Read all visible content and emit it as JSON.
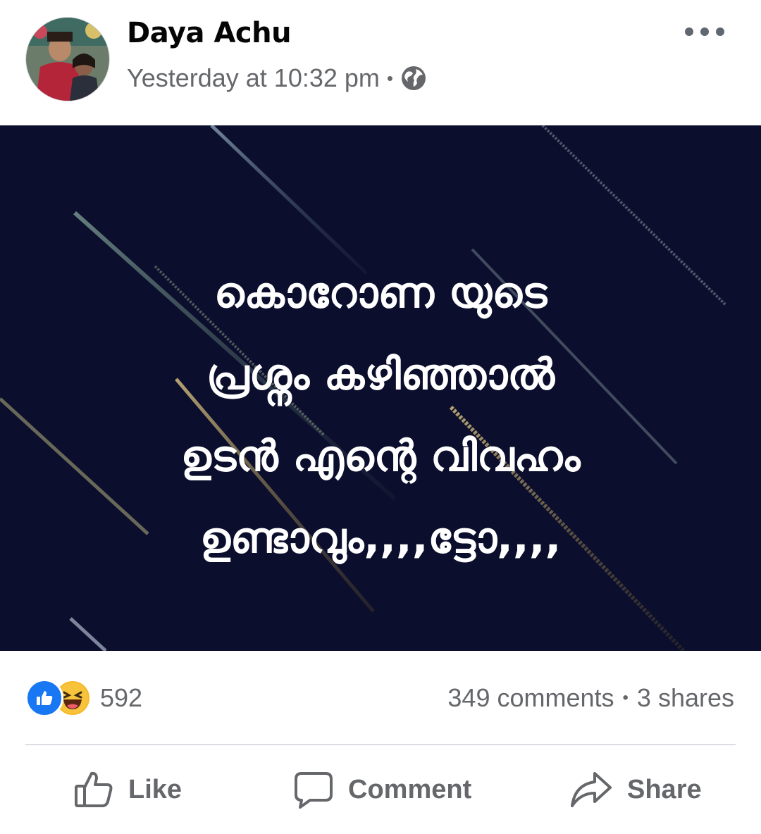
{
  "post": {
    "author": "Daya Achu",
    "timestamp": "Yesterday at 10:32 pm",
    "separator": "•",
    "privacy_icon": "globe-icon",
    "more_icon": "more-options-icon"
  },
  "image_text": {
    "line1": "കൊറോണ യുടെ",
    "line2": "പ്രശ്നം കഴിഞ്ഞാൽ",
    "line3": "ഉടൻ എന്റെ വിവഹം",
    "line4": "ഉണ്ടാവും,,,,ട്ടോ,,,,"
  },
  "stats": {
    "reaction_count": "592",
    "reaction_icons": [
      "like-reaction-icon",
      "haha-reaction-icon"
    ],
    "comments": "349 comments",
    "separator": "•",
    "shares": "3 shares"
  },
  "actions": {
    "like_label": "Like",
    "comment_label": "Comment",
    "share_label": "Share"
  },
  "colors": {
    "image_background": "#0b0e2c",
    "like_blue": "#1877f2",
    "haha_yellow": "#f7b928",
    "secondary_text": "#65676b"
  }
}
